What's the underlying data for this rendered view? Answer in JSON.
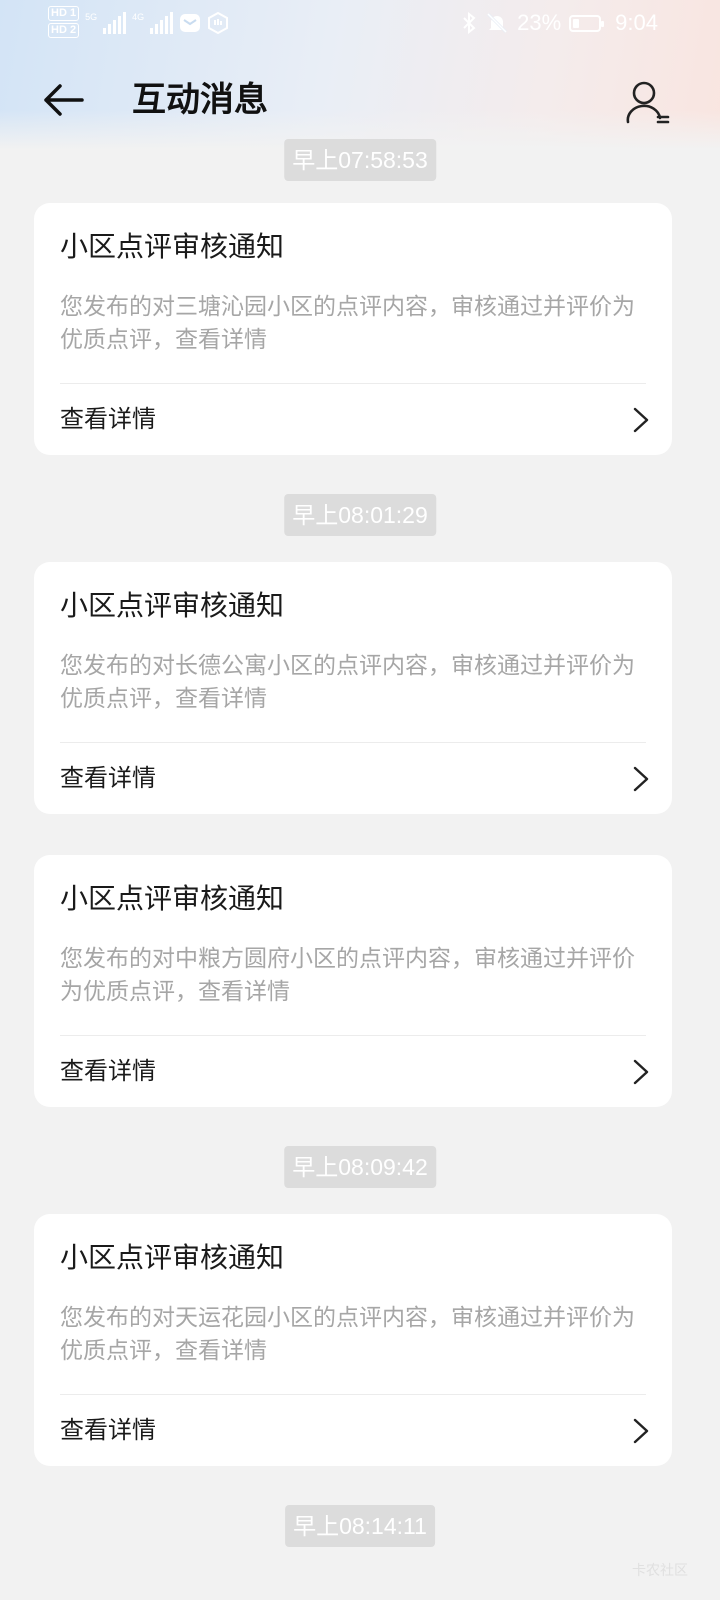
{
  "status_bar": {
    "hd1": "HD 1",
    "hd2": "HD 2",
    "net1": "5G",
    "net2": "4G",
    "battery": "23%",
    "time": "9:04"
  },
  "nav": {
    "title": "互动消息"
  },
  "timestamps": [
    "早上07:58:53",
    "早上08:01:29",
    "早上08:09:42",
    "早上08:14:11"
  ],
  "cards": [
    {
      "title": "小区点评审核通知",
      "body": "您发布的对三塘沁园小区的点评内容，审核通过并评价为优质点评，查看详情",
      "action": "查看详情"
    },
    {
      "title": "小区点评审核通知",
      "body": "您发布的对长德公寓小区的点评内容，审核通过并评价为优质点评，查看详情",
      "action": "查看详情"
    },
    {
      "title": "小区点评审核通知",
      "body": "您发布的对中粮方圆府小区的点评内容，审核通过并评价为优质点评，查看详情",
      "action": "查看详情"
    },
    {
      "title": "小区点评审核通知",
      "body": "您发布的对天运花园小区的点评内容，审核通过并评价为优质点评，查看详情",
      "action": "查看详情"
    }
  ],
  "watermark": "卡农社区"
}
